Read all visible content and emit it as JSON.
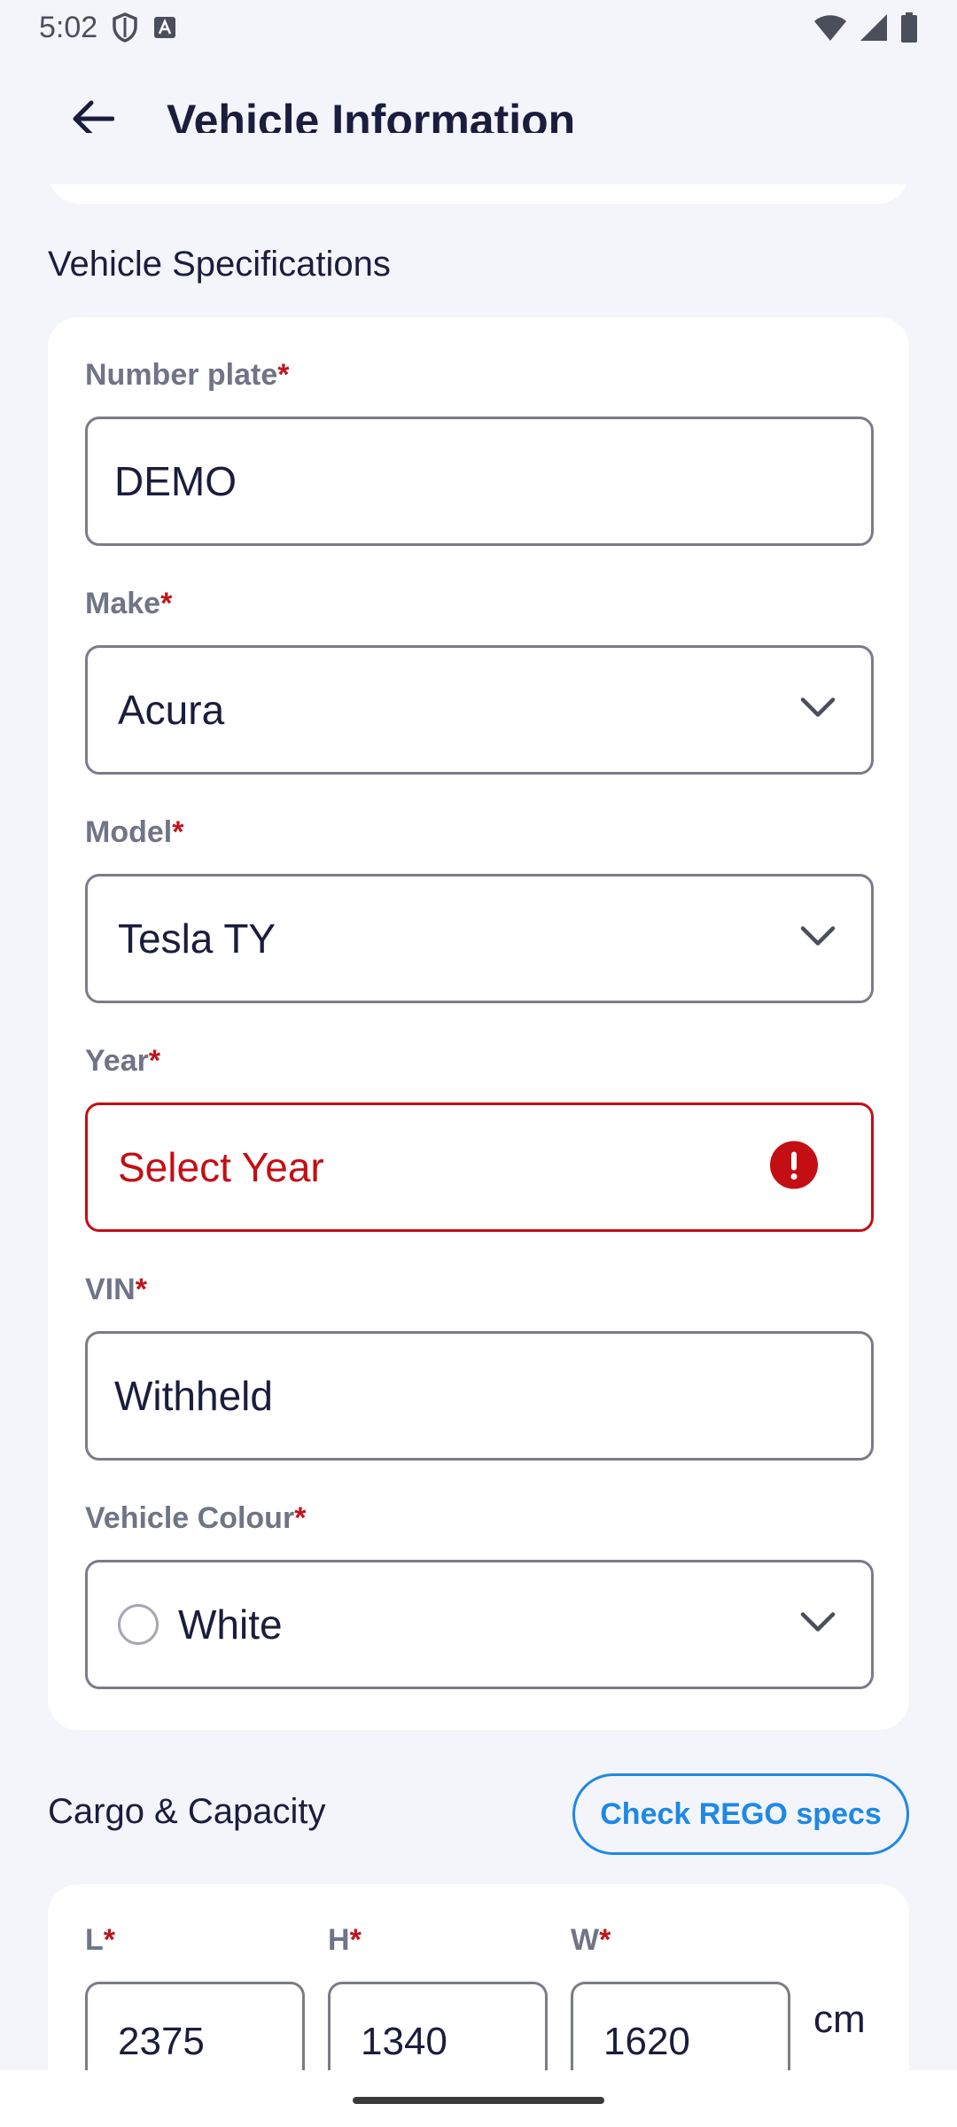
{
  "status_bar": {
    "time": "5:02"
  },
  "app_bar": {
    "title": "Vehicle Information"
  },
  "specs": {
    "section_title": "Vehicle Specifications",
    "number_plate": {
      "label": "Number plate",
      "value": "DEMO"
    },
    "make": {
      "label": "Make",
      "value": "Acura"
    },
    "model": {
      "label": "Model",
      "value": "Tesla TY"
    },
    "year": {
      "label": "Year",
      "placeholder": "Select Year"
    },
    "vin": {
      "label": "VIN",
      "value": "Withheld"
    },
    "colour": {
      "label": "Vehicle Colour",
      "value": "White"
    },
    "required_marker": "*"
  },
  "cargo": {
    "section_title": "Cargo & Capacity",
    "check_button": "Check REGO specs",
    "length": {
      "label": "L",
      "value": "2375"
    },
    "height": {
      "label": "H",
      "value": "1340"
    },
    "width": {
      "label": "W",
      "value": "1620"
    },
    "unit": "cm"
  },
  "colors": {
    "accent": "#1e88e5",
    "error": "#c30f14",
    "required": "#c0141c"
  }
}
